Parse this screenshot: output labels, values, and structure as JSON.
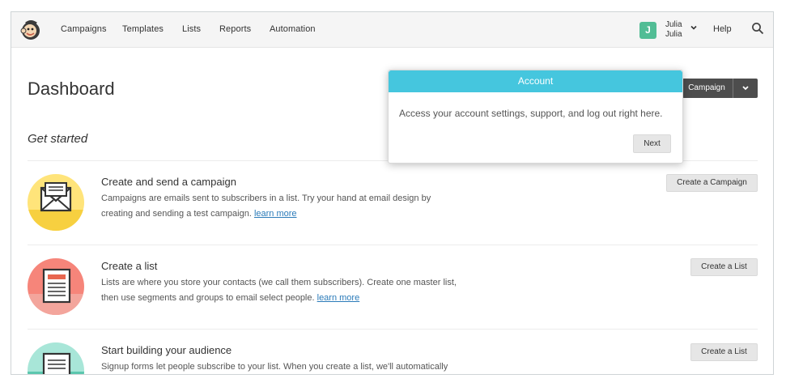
{
  "nav": {
    "items": [
      {
        "label": "Campaigns"
      },
      {
        "label": "Templates"
      },
      {
        "label": "Lists"
      },
      {
        "label": "Reports"
      },
      {
        "label": "Automation"
      }
    ],
    "avatar_initial": "J",
    "user_name": "Julia",
    "user_account": "Julia",
    "help_label": "Help",
    "icons": {
      "logo": "mailchimp-freddie-logo",
      "user_menu": "chevron-down-icon",
      "search": "search-icon"
    }
  },
  "page": {
    "title": "Dashboard",
    "create_campaign_label": "Campaign",
    "get_started": "Get started"
  },
  "rows": [
    {
      "title": "Create and send a campaign",
      "desc_line1": "Campaigns are emails sent to subscribers in a list. Try your hand at email design by",
      "desc_line2": "creating and sending a test campaign.",
      "link": "learn more",
      "button": "Create a Campaign",
      "icon": "envelope-icon"
    },
    {
      "title": "Create a list",
      "desc_line1": "Lists are where you store your contacts (we call them subscribers). Create one master list,",
      "desc_line2": "then use segments and groups to email select people.",
      "link": "learn more",
      "button": "Create a List",
      "icon": "list-document-icon"
    },
    {
      "title": "Start building your audience",
      "desc_line1": "Signup forms let people subscribe to your list. When you create a list, we'll automatically",
      "button": "Create a List",
      "icon": "signup-form-icon"
    }
  ],
  "popover": {
    "title": "Account",
    "body": "Access your account settings, support, and log out right here.",
    "next_label": "Next"
  },
  "colors": {
    "nav_bg": "#f5f5f5",
    "avatar": "#52bd95",
    "popover_header": "#45c6de",
    "link": "#2b7bb9",
    "icon_yellow": "#ffe47a",
    "icon_red": "#f6857a",
    "icon_teal": "#a8e6d8"
  }
}
